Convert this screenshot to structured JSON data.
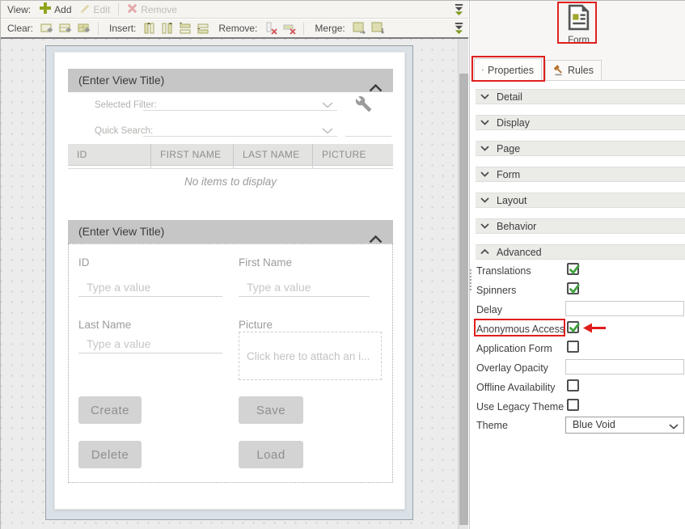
{
  "toolbar": {
    "row1": {
      "view_label": "View:",
      "add": "Add",
      "edit": "Edit",
      "remove": "Remove"
    },
    "row2": {
      "clear_label": "Clear:",
      "insert_label": "Insert:",
      "remove_label": "Remove:",
      "merge_label": "Merge:"
    }
  },
  "canvas": {
    "list_view": {
      "title": "(Enter View Title)",
      "selected_filter_label": "Selected Filter:",
      "quick_search_label": "Quick Search:",
      "columns": [
        "ID",
        "FIRST NAME",
        "LAST NAME",
        "PICTURE"
      ],
      "empty_message": "No items to display"
    },
    "item_view": {
      "title": "(Enter View Title)",
      "fields": [
        {
          "label": "ID",
          "placeholder": "Type a value"
        },
        {
          "label": "First Name",
          "placeholder": "Type a value"
        },
        {
          "label": "Last Name",
          "placeholder": "Type a value"
        },
        {
          "label": "Picture",
          "placeholder": "Click here to attach an i..."
        }
      ],
      "buttons": [
        "Create",
        "Save",
        "Delete",
        "Load"
      ]
    }
  },
  "panel": {
    "object_label": "Form",
    "tabs": [
      {
        "label": "Properties",
        "selected": true
      },
      {
        "label": "Rules",
        "selected": false
      }
    ],
    "sections": [
      "Detail",
      "Display",
      "Page",
      "Form",
      "Layout",
      "Behavior",
      "Advanced"
    ],
    "advanced": {
      "rows": [
        {
          "label": "Translations",
          "type": "checkbox",
          "checked": true
        },
        {
          "label": "Spinners",
          "type": "checkbox",
          "checked": true
        },
        {
          "label": "Delay",
          "type": "text",
          "value": ""
        },
        {
          "label": "Anonymous Access",
          "type": "checkbox",
          "checked": true,
          "highlighted": true
        },
        {
          "label": "Application Form",
          "type": "checkbox",
          "checked": false
        },
        {
          "label": "Overlay Opacity",
          "type": "text",
          "value": ""
        },
        {
          "label": "Offline Availability",
          "type": "checkbox",
          "checked": false
        },
        {
          "label": "Use Legacy Theme",
          "type": "checkbox",
          "checked": false
        },
        {
          "label": "Theme",
          "type": "select",
          "value": "Blue Void"
        }
      ]
    }
  },
  "colors": {
    "accent_olive": "#93a41f",
    "annotation_red": "#e01f1f",
    "check_green": "#3fa33f",
    "rules_gavel": "#b5732c"
  }
}
